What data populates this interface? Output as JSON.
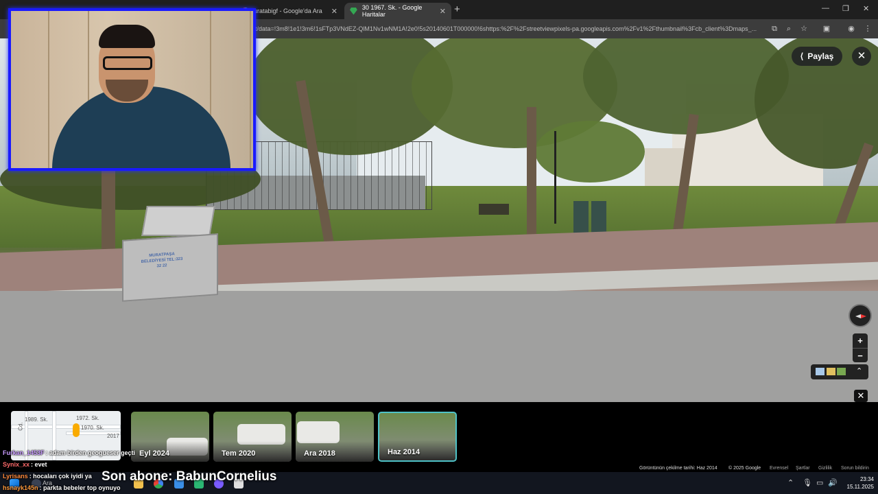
{
  "browser": {
    "tabs": [
      {
        "title": "",
        "active": false
      },
      {
        "title": "",
        "active": false
      },
      {
        "title": "uratabigf - Google'da Ara",
        "active": false
      },
      {
        "title": "30 1967. Sk. - Google Haritalar",
        "active": true
      }
    ],
    "url": "t/data=!3m8!1e1!3m6!1sFTp3VNdEZ-QlM1Nv1wNM1A!2e0!5s20140601T000000!6shttps:%2F%2Fstreetviewpixels-pa.googleapis.com%2Fv1%2Fthumbnail%3Fcb_client%3Dmaps_..."
  },
  "streetview": {
    "share_label": "Paylaş",
    "bin_text": "MURATPAŞA BELEDİYESİ TEL:323 32 22"
  },
  "timeline": {
    "minimap_labels": [
      "1989. Sk.",
      "1972. Sk.",
      "1970. Sk.",
      "2017",
      "Cd."
    ],
    "thumbnails": [
      {
        "label": "Eyl 2024",
        "selected": false
      },
      {
        "label": "Tem 2020",
        "selected": false
      },
      {
        "label": "Ara 2018",
        "selected": false
      },
      {
        "label": "Haz 2014",
        "selected": true
      }
    ]
  },
  "credits": {
    "capture_date": "Görüntünün çekilme tarihi: Haz 2014",
    "copyright": "© 2025 Google",
    "links": [
      "Evrensel",
      "Şartlar",
      "Gizlilik",
      "Sorun bildirin"
    ]
  },
  "chat": [
    {
      "user": "Furkan_1453F",
      "message": ": adam birden geogueser geçti",
      "color": "#c99cff"
    },
    {
      "user": "Synix_xx",
      "message": ": evet",
      "color": "#ff6b6b"
    },
    {
      "user": "Lyrisans",
      "message": ": hocaları çok iyidi ya",
      "color": "#ff8a3d"
    },
    {
      "user": "hsnayk145n",
      "message": ": parkta bebeler top oynuyo",
      "color": "#ff9a3d"
    }
  ],
  "overlay": {
    "last_subscriber": "Son abone: BabunCornelius"
  },
  "taskbar": {
    "search_label": "Ara",
    "time": "23:34",
    "date": "15.11.2025"
  },
  "icons": [
    "share-icon",
    "close-icon",
    "compass-icon",
    "zoom-in-icon",
    "zoom-out-icon",
    "layers-icon",
    "chevron-up-icon",
    "windows-icon",
    "mic-icon",
    "speaker-icon",
    "network-icon"
  ]
}
